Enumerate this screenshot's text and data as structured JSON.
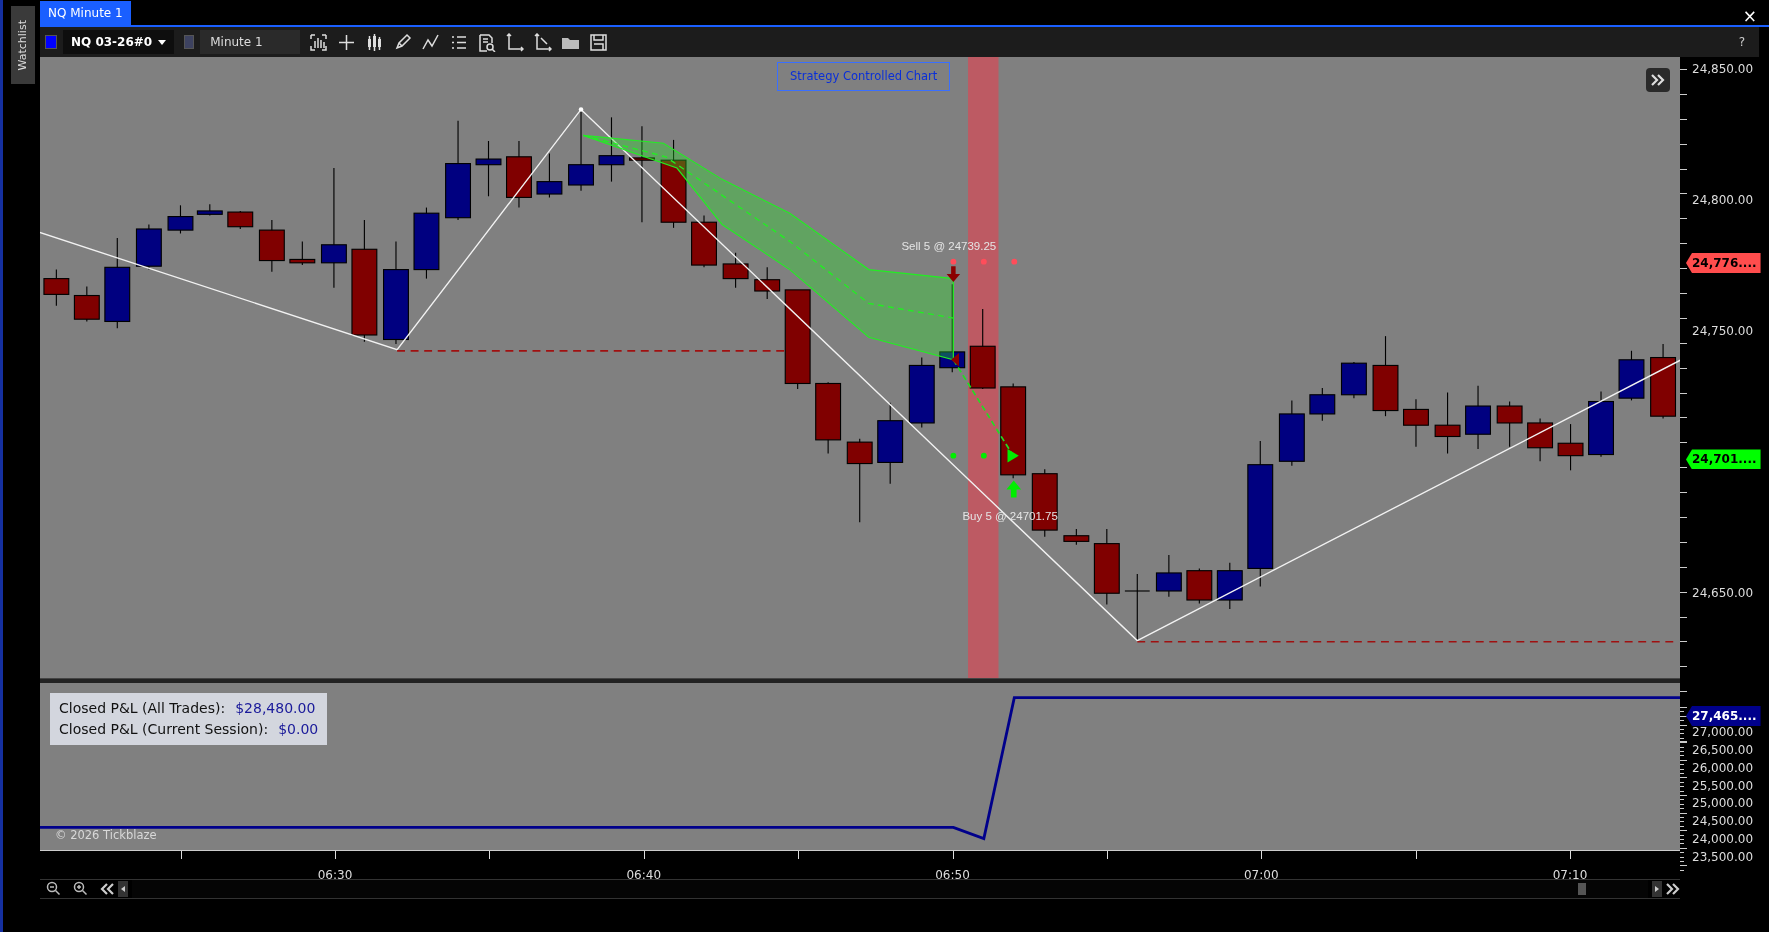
{
  "window": {
    "tabs": [
      {
        "label": "NQ Minute 1",
        "selected": true
      }
    ],
    "close": "×"
  },
  "sidebar": {
    "tabs": [
      {
        "label": "Watchlist",
        "selected": false
      }
    ]
  },
  "toolbar": {
    "instrument": "NQ 03-26#0",
    "timeframe": "Minute 1",
    "help": "?"
  },
  "chart": {
    "banner": "Strategy Controlled Chart",
    "trades": [
      {
        "kind": "sell",
        "label": "Sell 5 @ 24739.25"
      },
      {
        "kind": "buy",
        "label": "Buy 5 @ 24701.75"
      }
    ],
    "price_axis": {
      "labels": [
        "24,850.00",
        "24,800.00",
        "24,750.00",
        "24,650.00"
      ],
      "markers": [
        {
          "label": "24,776....",
          "color": "#ff4d4d"
        },
        {
          "label": "24,701....",
          "color": "#00ff00"
        }
      ]
    }
  },
  "pnl_pane": {
    "legend": [
      {
        "label": "Closed P&L (All Trades):",
        "value": "$28,480.00"
      },
      {
        "label": "Closed P&L (Current Session):",
        "value": "$0.00"
      }
    ],
    "copyright": "© 2026 Tickblaze",
    "marker": "27,465....",
    "axis_labels": [
      "27,000.00",
      "26,500.00",
      "26,000.00",
      "25,500.00",
      "25,000.00",
      "24,500.00",
      "24,000.00",
      "23,500.00"
    ]
  },
  "time_axis": {
    "labels": [
      "06:30",
      "06:40",
      "06:50",
      "07:00",
      "07:10"
    ]
  }
}
